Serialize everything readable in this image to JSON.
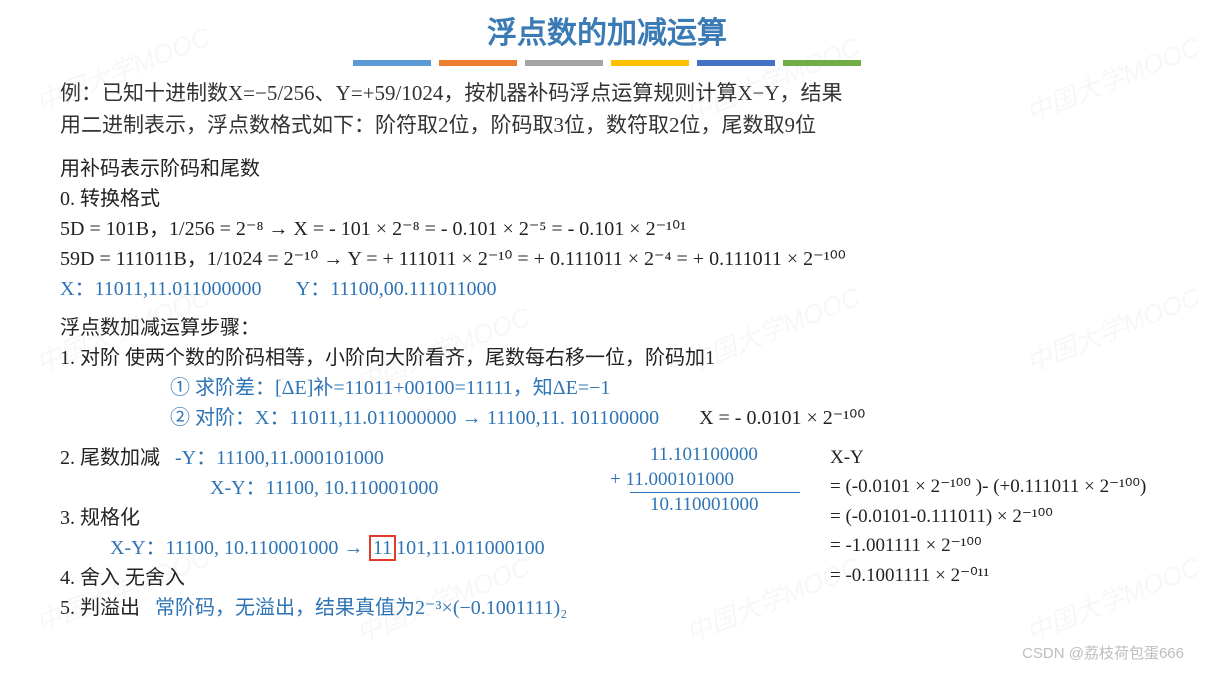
{
  "title": "浮点数的加减运算",
  "bars": [
    "#5b9bd5",
    "#ed7d31",
    "#a5a5a5",
    "#ffc000",
    "#4472c4",
    "#70ad47"
  ],
  "problem_l1": "例：已知十进制数X=−5/256、Y=+59/1024，按机器补码浮点运算规则计算X−Y，结果",
  "problem_l2": "用二进制表示，浮点数格式如下：阶符取2位，阶码取3位，数符取2位，尾数取9位",
  "sec0_title": "用补码表示阶码和尾数",
  "step0_h": "0.  转换格式",
  "step0_l1": "5D = 101B，1/256 = 2⁻⁸ → X = - 101 × 2⁻⁸ = - 0.101 × 2⁻⁵ = - 0.101 × 2⁻¹⁰¹",
  "step0_l2": "59D = 111011B，1/1024 = 2⁻¹⁰ → Y = + 111011 × 2⁻¹⁰ = + 0.111011 × 2⁻⁴ = + 0.111011 × 2⁻¹⁰⁰",
  "xy_line_x": "X：11011,11.011000000",
  "xy_line_y": "Y：11100,00.111011000",
  "steps_title": "浮点数加减运算步骤：",
  "step1_h": "1.   对阶  使两个数的阶码相等，小阶向大阶看齐，尾数每右移一位，阶码加1",
  "step1_sub1": "① 求阶差：[ΔE]补=11011+00100=11111，知ΔE=−1",
  "step1_sub2a": "② 对阶：X：11011,11.011000000",
  "step1_sub2b": "11100,11. 101100000",
  "step1_right": "X = - 0.0101 × 2⁻¹⁰⁰",
  "step2_h": "2.   尾数加减",
  "step2_nY": "-Y：11100,11.000101000",
  "step2_XY": "X-Y：11100, 10.110001000",
  "calc_a": "11.101100000",
  "calc_plus": "+     11.000101000",
  "calc_res": "10.110001000",
  "step3_h": "3.   规格化",
  "step3_line_a": "X-Y：11100, 10.110001000",
  "step3_box": "11",
  "step3_line_b": "101,11.011000100",
  "step4_h": "4.   舍入       无舍入",
  "step5_h": "5.   判溢出",
  "step5_blue": "常阶码，无溢出，结果真值为2⁻³×(−0.1001111)₂",
  "eq_h": "X-Y",
  "eq1": "= (-0.0101 × 2⁻¹⁰⁰ )- (+0.111011 × 2⁻¹⁰⁰)",
  "eq2": "= (-0.0101-0.111011) × 2⁻¹⁰⁰",
  "eq3": "= -1.001111 × 2⁻¹⁰⁰",
  "eq4": "= -0.1001111 × 2⁻⁰¹¹",
  "wm": "中国大学MOOC",
  "csdn": "CSDN @荔枝荷包蛋666"
}
